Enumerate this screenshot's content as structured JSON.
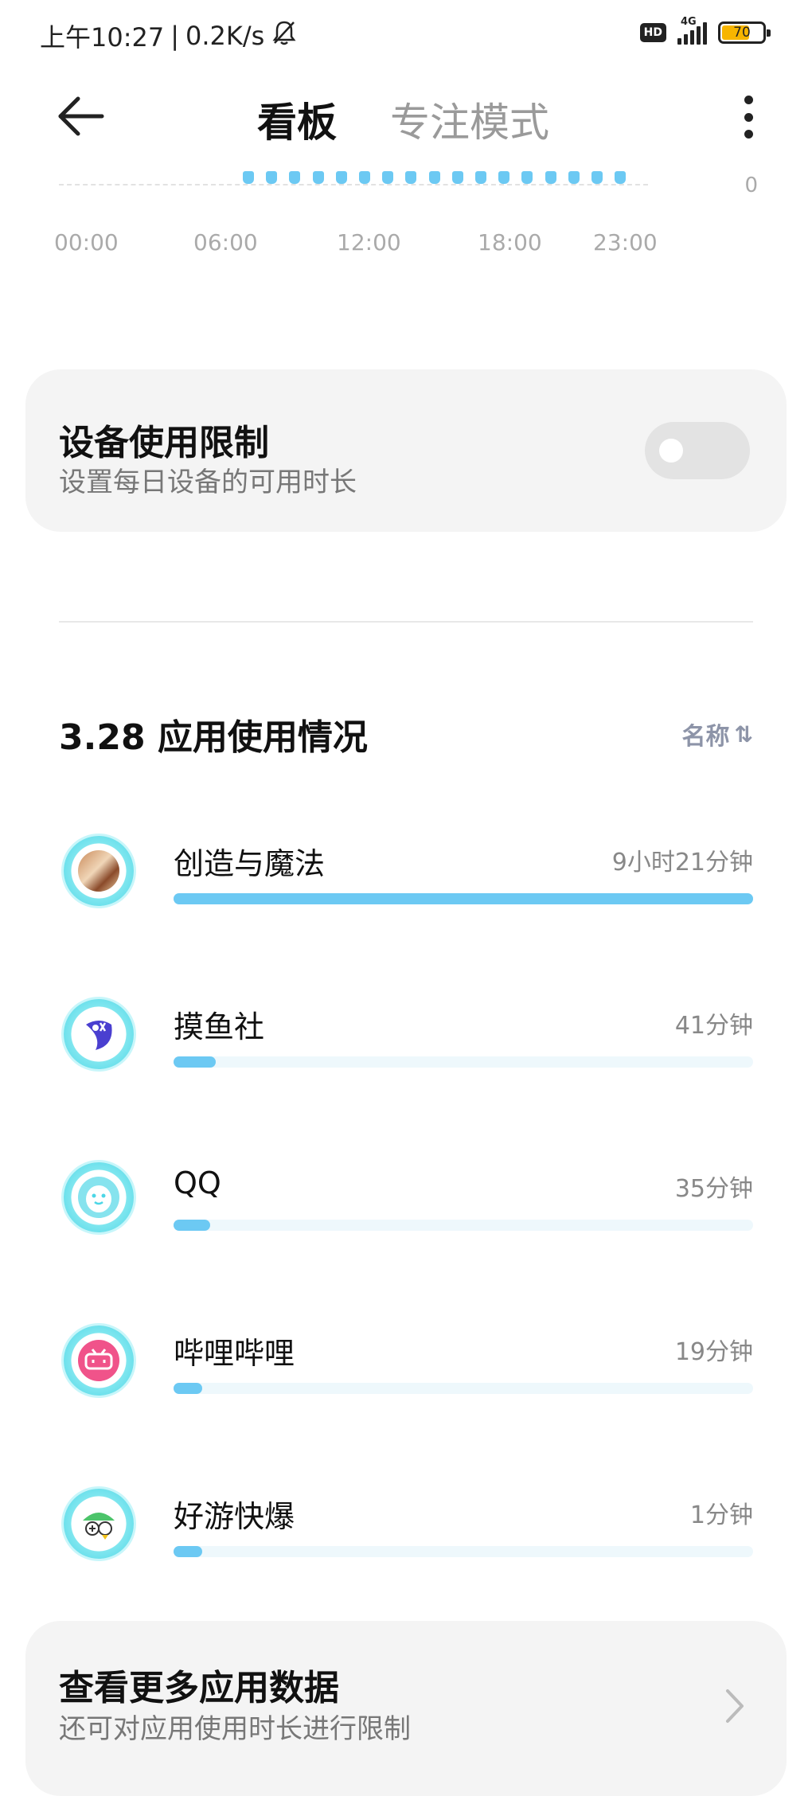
{
  "status_bar": {
    "time": "上午10:27",
    "net_speed": "0.2K/s",
    "hd": "HD",
    "network": "4G",
    "battery": "70",
    "battery_level": 0.7
  },
  "header": {
    "tab_active": "看板",
    "tab_inactive": "专注模式"
  },
  "timeline": {
    "zero_label": "0",
    "time_labels": [
      "00:00",
      "06:00",
      "12:00",
      "18:00",
      "23:00"
    ]
  },
  "device_limit": {
    "title": "设备使用限制",
    "subtitle": "设置每日设备的可用时长",
    "enabled": false
  },
  "usage": {
    "title": "3.28 应用使用情况",
    "sort_label": "名称",
    "sort_arrow": "⇅",
    "apps": [
      {
        "name": "创造与魔法",
        "time": "9小时21分钟",
        "progress": 1.0
      },
      {
        "name": "摸鱼社",
        "time": "41分钟",
        "progress": 0.073
      },
      {
        "name": "QQ",
        "time": "35分钟",
        "progress": 0.063
      },
      {
        "name": "哔哩哔哩",
        "time": "19分钟",
        "progress": 0.05
      },
      {
        "name": "好游快爆",
        "time": "1分钟",
        "progress": 0.05
      }
    ]
  },
  "more_data": {
    "title": "查看更多应用数据",
    "subtitle": "还可对应用使用时长进行限制"
  },
  "colors": {
    "accent": "#6cc9f3",
    "track": "#eef8fc",
    "card": "#f4f4f4",
    "icon_ring": "#4cd6e6"
  }
}
